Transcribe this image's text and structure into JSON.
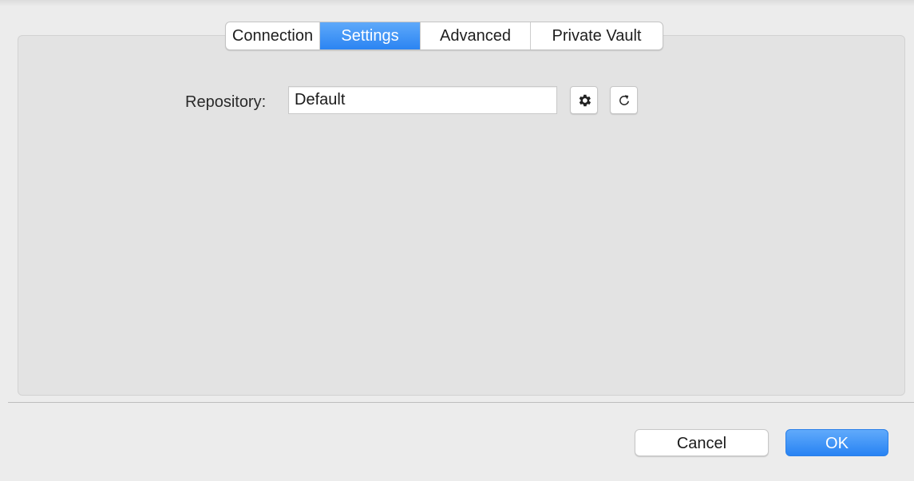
{
  "tabs": [
    {
      "label": "Connection",
      "active": false
    },
    {
      "label": "Settings",
      "active": true
    },
    {
      "label": "Advanced",
      "active": false
    },
    {
      "label": "Private Vault",
      "active": false
    }
  ],
  "settings": {
    "repository_label": "Repository:",
    "repository_value": "Default",
    "gear_icon": "gear-icon",
    "refresh_icon": "refresh-icon"
  },
  "footer": {
    "cancel_label": "Cancel",
    "ok_label": "OK"
  },
  "colors": {
    "accent": "#2b84f2",
    "panel_bg": "#e3e3e3",
    "window_bg": "#ececec"
  }
}
